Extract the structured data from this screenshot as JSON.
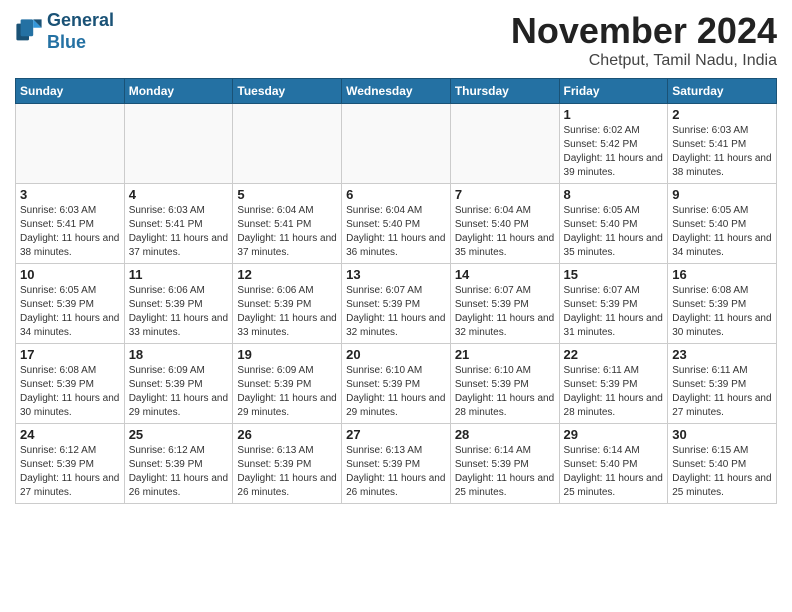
{
  "logo": {
    "line1": "General",
    "line2": "Blue"
  },
  "title": "November 2024",
  "location": "Chetput, Tamil Nadu, India",
  "headers": [
    "Sunday",
    "Monday",
    "Tuesday",
    "Wednesday",
    "Thursday",
    "Friday",
    "Saturday"
  ],
  "weeks": [
    [
      {
        "day": "",
        "info": ""
      },
      {
        "day": "",
        "info": ""
      },
      {
        "day": "",
        "info": ""
      },
      {
        "day": "",
        "info": ""
      },
      {
        "day": "",
        "info": ""
      },
      {
        "day": "1",
        "info": "Sunrise: 6:02 AM\nSunset: 5:42 PM\nDaylight: 11 hours and 39 minutes."
      },
      {
        "day": "2",
        "info": "Sunrise: 6:03 AM\nSunset: 5:41 PM\nDaylight: 11 hours and 38 minutes."
      }
    ],
    [
      {
        "day": "3",
        "info": "Sunrise: 6:03 AM\nSunset: 5:41 PM\nDaylight: 11 hours and 38 minutes."
      },
      {
        "day": "4",
        "info": "Sunrise: 6:03 AM\nSunset: 5:41 PM\nDaylight: 11 hours and 37 minutes."
      },
      {
        "day": "5",
        "info": "Sunrise: 6:04 AM\nSunset: 5:41 PM\nDaylight: 11 hours and 37 minutes."
      },
      {
        "day": "6",
        "info": "Sunrise: 6:04 AM\nSunset: 5:40 PM\nDaylight: 11 hours and 36 minutes."
      },
      {
        "day": "7",
        "info": "Sunrise: 6:04 AM\nSunset: 5:40 PM\nDaylight: 11 hours and 35 minutes."
      },
      {
        "day": "8",
        "info": "Sunrise: 6:05 AM\nSunset: 5:40 PM\nDaylight: 11 hours and 35 minutes."
      },
      {
        "day": "9",
        "info": "Sunrise: 6:05 AM\nSunset: 5:40 PM\nDaylight: 11 hours and 34 minutes."
      }
    ],
    [
      {
        "day": "10",
        "info": "Sunrise: 6:05 AM\nSunset: 5:39 PM\nDaylight: 11 hours and 34 minutes."
      },
      {
        "day": "11",
        "info": "Sunrise: 6:06 AM\nSunset: 5:39 PM\nDaylight: 11 hours and 33 minutes."
      },
      {
        "day": "12",
        "info": "Sunrise: 6:06 AM\nSunset: 5:39 PM\nDaylight: 11 hours and 33 minutes."
      },
      {
        "day": "13",
        "info": "Sunrise: 6:07 AM\nSunset: 5:39 PM\nDaylight: 11 hours and 32 minutes."
      },
      {
        "day": "14",
        "info": "Sunrise: 6:07 AM\nSunset: 5:39 PM\nDaylight: 11 hours and 32 minutes."
      },
      {
        "day": "15",
        "info": "Sunrise: 6:07 AM\nSunset: 5:39 PM\nDaylight: 11 hours and 31 minutes."
      },
      {
        "day": "16",
        "info": "Sunrise: 6:08 AM\nSunset: 5:39 PM\nDaylight: 11 hours and 30 minutes."
      }
    ],
    [
      {
        "day": "17",
        "info": "Sunrise: 6:08 AM\nSunset: 5:39 PM\nDaylight: 11 hours and 30 minutes."
      },
      {
        "day": "18",
        "info": "Sunrise: 6:09 AM\nSunset: 5:39 PM\nDaylight: 11 hours and 29 minutes."
      },
      {
        "day": "19",
        "info": "Sunrise: 6:09 AM\nSunset: 5:39 PM\nDaylight: 11 hours and 29 minutes."
      },
      {
        "day": "20",
        "info": "Sunrise: 6:10 AM\nSunset: 5:39 PM\nDaylight: 11 hours and 29 minutes."
      },
      {
        "day": "21",
        "info": "Sunrise: 6:10 AM\nSunset: 5:39 PM\nDaylight: 11 hours and 28 minutes."
      },
      {
        "day": "22",
        "info": "Sunrise: 6:11 AM\nSunset: 5:39 PM\nDaylight: 11 hours and 28 minutes."
      },
      {
        "day": "23",
        "info": "Sunrise: 6:11 AM\nSunset: 5:39 PM\nDaylight: 11 hours and 27 minutes."
      }
    ],
    [
      {
        "day": "24",
        "info": "Sunrise: 6:12 AM\nSunset: 5:39 PM\nDaylight: 11 hours and 27 minutes."
      },
      {
        "day": "25",
        "info": "Sunrise: 6:12 AM\nSunset: 5:39 PM\nDaylight: 11 hours and 26 minutes."
      },
      {
        "day": "26",
        "info": "Sunrise: 6:13 AM\nSunset: 5:39 PM\nDaylight: 11 hours and 26 minutes."
      },
      {
        "day": "27",
        "info": "Sunrise: 6:13 AM\nSunset: 5:39 PM\nDaylight: 11 hours and 26 minutes."
      },
      {
        "day": "28",
        "info": "Sunrise: 6:14 AM\nSunset: 5:39 PM\nDaylight: 11 hours and 25 minutes."
      },
      {
        "day": "29",
        "info": "Sunrise: 6:14 AM\nSunset: 5:40 PM\nDaylight: 11 hours and 25 minutes."
      },
      {
        "day": "30",
        "info": "Sunrise: 6:15 AM\nSunset: 5:40 PM\nDaylight: 11 hours and 25 minutes."
      }
    ]
  ]
}
